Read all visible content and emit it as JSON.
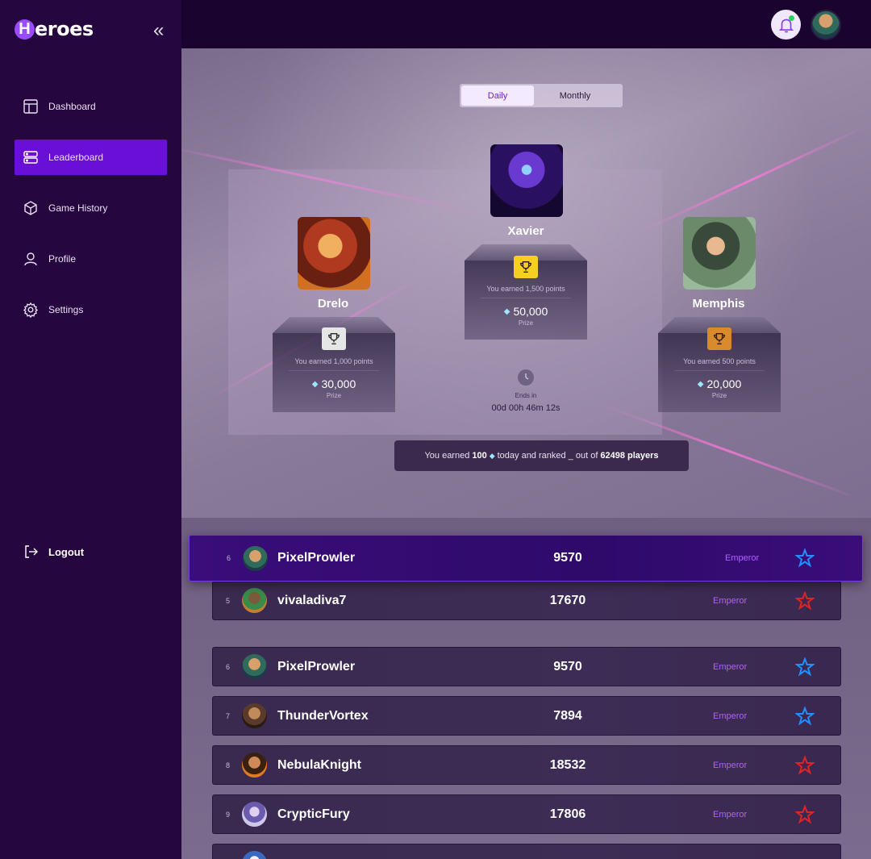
{
  "app": {
    "logo_letter": "H",
    "logo_rest": "eroes"
  },
  "sidebar": {
    "collapse_icon": "«",
    "items": [
      {
        "label": "Dashboard",
        "icon": "layout-icon"
      },
      {
        "label": "Leaderboard",
        "icon": "server-icon",
        "active": true
      },
      {
        "label": "Game History",
        "icon": "cube-icon"
      },
      {
        "label": "Profile",
        "icon": "user-icon"
      },
      {
        "label": "Settings",
        "icon": "gear-icon"
      }
    ],
    "logout_label": "Logout"
  },
  "toggle": {
    "daily": "Daily",
    "monthly": "Monthly"
  },
  "podium": {
    "first": {
      "name": "Xavier",
      "earned": "You earned 1,500 points",
      "prize": "50,000",
      "prize_label": "Prize",
      "trophy_color": "#f5d020"
    },
    "second": {
      "name": "Drelo",
      "earned": "You earned 1,000 points",
      "prize": "30,000",
      "prize_label": "Prize",
      "trophy_color": "#e6e6e6"
    },
    "third": {
      "name": "Memphis",
      "earned": "You earned 500 points",
      "prize": "20,000",
      "prize_label": "Prize",
      "trophy_color": "#d98b2b"
    }
  },
  "countdown": {
    "label": "Ends in",
    "value": "00d 00h 46m 12s"
  },
  "banner": {
    "prefix": "You earned",
    "amount": "100",
    "middle": "today and ranked _ out of",
    "players": "62498 players"
  },
  "current_user": {
    "rank": "6",
    "name": "PixelProwler",
    "score": "9570",
    "tier": "Emperor",
    "star_color": "#1e90ff"
  },
  "rows": [
    {
      "rank": "5",
      "name": "vivaladiva7",
      "score": "17670",
      "tier": "Emperor",
      "star_color": "#e02424"
    },
    {
      "rank": "6",
      "name": "PixelProwler",
      "score": "9570",
      "tier": "Emperor",
      "star_color": "#1e90ff"
    },
    {
      "rank": "7",
      "name": "ThunderVortex",
      "score": "7894",
      "tier": "Emperor",
      "star_color": "#1e90ff"
    },
    {
      "rank": "8",
      "name": "NebulaKnight",
      "score": "18532",
      "tier": "Emperor",
      "star_color": "#e02424"
    },
    {
      "rank": "9",
      "name": "CrypticFury",
      "score": "17806",
      "tier": "Emperor",
      "star_color": "#e02424"
    }
  ],
  "colors": {
    "accent": "#6a0fd8",
    "tier": "#b160ff"
  }
}
